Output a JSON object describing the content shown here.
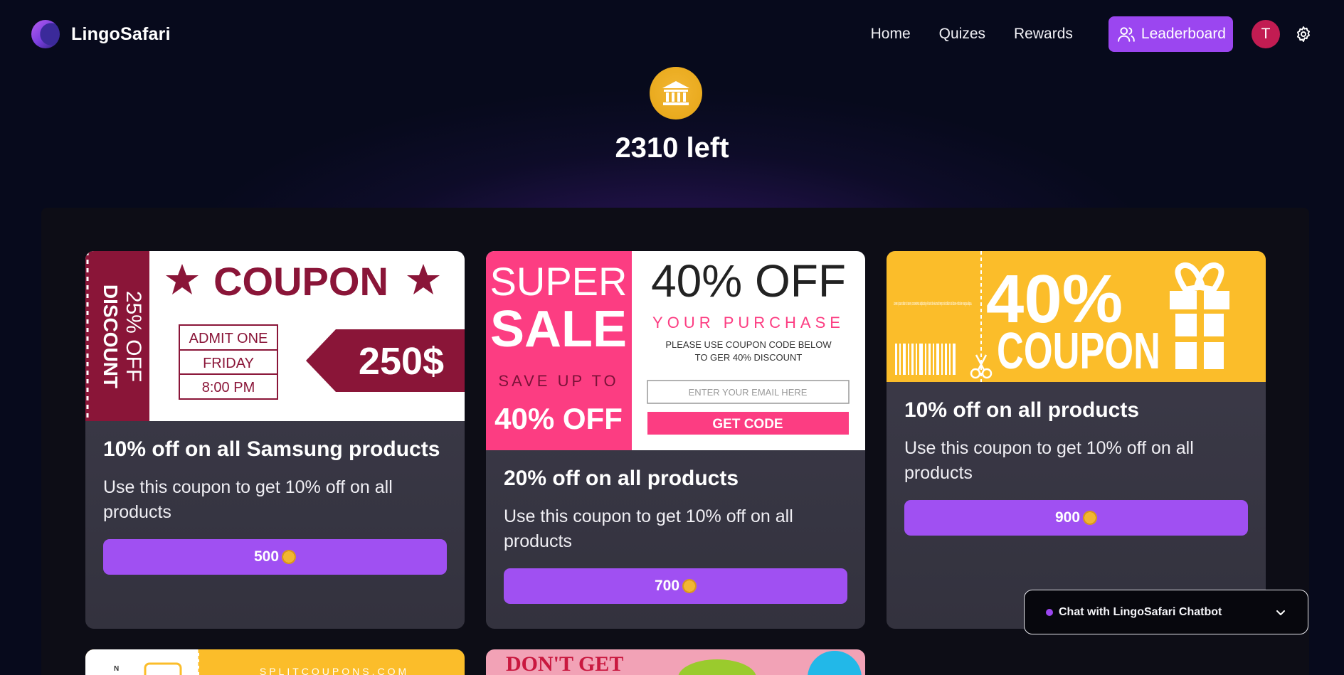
{
  "app": {
    "name": "LingoSafari"
  },
  "nav": {
    "links": [
      "Home",
      "Quizes",
      "Rewards"
    ],
    "leaderboard_label": "Leaderboard",
    "avatar_initial": "T"
  },
  "balance": {
    "text": "2310 left"
  },
  "rewards": [
    {
      "title": "10% off on all Samsung products",
      "description": "Use this coupon to get 10% off on all products",
      "price": "500",
      "image": {
        "side_top": "25% OFF",
        "side_bottom": "DISCOUNT",
        "heading": "COUPON",
        "rows": [
          "ADMIT ONE",
          "FRIDAY",
          "8:00 PM"
        ],
        "amount": "250$"
      }
    },
    {
      "title": "20% off on all products",
      "description": "Use this coupon to get 10% off on all products",
      "price": "700",
      "image": {
        "super": "SUPER",
        "sale": "SALE",
        "save": "SAVE UP TO",
        "save_pct": "40% OFF",
        "headline": "40% OFF",
        "sub": "YOUR PURCHASE",
        "line1": "PLEASE USE COUPON CODE BELOW",
        "line2": "TO GER 40% DISCOUNT",
        "email_placeholder": "ENTER YOUR EMAIL HERE",
        "cta": "GET CODE"
      }
    },
    {
      "title": "10% off on all products",
      "description": "Use this coupon to get 10% off on all products",
      "price": "900",
      "image": {
        "pct": "40%",
        "word": "COUPON",
        "fine": "Lorem ipsum dolor sit amet, consectetur adipiscing elit sed do eiusmod tempor incididunt ut labore et dolore magna aliqua."
      }
    }
  ],
  "partial_cards": {
    "card4_text": "SPLITCOUPONS.COM",
    "card5_text": "DON'T GET"
  },
  "chat": {
    "label": "Chat with LingoSafari Chatbot"
  },
  "colors": {
    "accent": "#9b46f0",
    "background": "#070a1c",
    "card": "#3e3c4b",
    "coin": "#f2b632"
  }
}
